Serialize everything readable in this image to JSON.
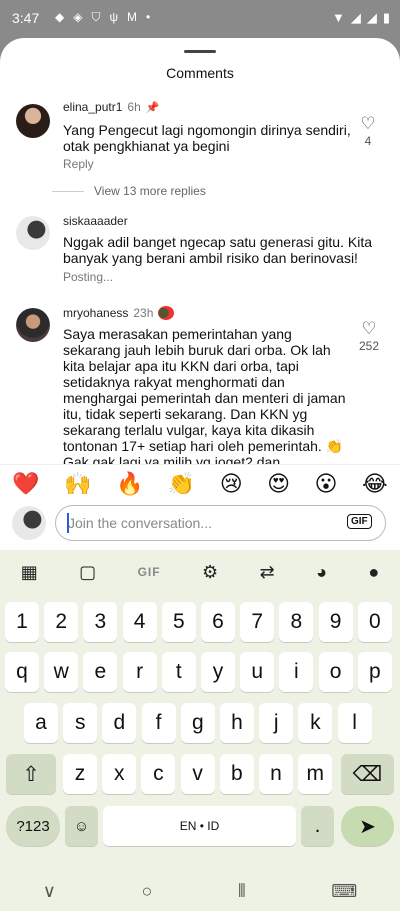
{
  "status_bar": {
    "time": "3:47",
    "left_icons": [
      "message-icon",
      "hotspot-icon",
      "vpn-icon",
      "usb-icon",
      "gmail-icon",
      "dot-icon"
    ],
    "right_icons": [
      "wifi-icon",
      "signal-icon",
      "signal-icon",
      "battery-icon"
    ]
  },
  "sheet": {
    "title": "Comments"
  },
  "comments": [
    {
      "username": "elina_putr1",
      "time": "6h",
      "pinned": true,
      "text": "Yang Pengecut lagi ngomongin dirinya sendiri, otak pengkhianat ya begini",
      "reply_label": "Reply",
      "likes": "4",
      "view_replies": "View 13 more replies"
    },
    {
      "username": "siskaaaader",
      "text": "Nggak adil banget ngecap satu generasi gitu. Kita banyak yang berani ambil risiko dan berinovasi!",
      "status": "Posting..."
    },
    {
      "username": "mryohaness",
      "time": "23h",
      "likes": "252",
      "text": "Saya merasakan pemerintahan yang sekarang jauh lebih buruk dari orba. Ok lah kita belajar apa itu KKN dari orba, tapi setidaknya rakyat menghormati dan menghargai pemerintah dan menteri di jaman itu, tidak seperti sekarang. Dan KKN yg sekarang terlalu vulgar, kaya kita dikasih tontonan 17+ setiap hari oleh pemerintah. 👏 Gak gak lagi ya milih yg joget2 dan"
    }
  ],
  "emoji_bar": [
    "❤️",
    "🙌",
    "🔥",
    "👏",
    "😢",
    "😍",
    "😮",
    "😂"
  ],
  "input": {
    "placeholder": "Join the conversation...",
    "gif_label": "GIF"
  },
  "keyboard": {
    "toolbar": {
      "gif_label": "GIF"
    },
    "row_numbers": [
      "1",
      "2",
      "3",
      "4",
      "5",
      "6",
      "7",
      "8",
      "9",
      "0"
    ],
    "row1": [
      "q",
      "w",
      "e",
      "r",
      "t",
      "y",
      "u",
      "i",
      "o",
      "p"
    ],
    "row2": [
      "a",
      "s",
      "d",
      "f",
      "g",
      "h",
      "j",
      "k",
      "l"
    ],
    "row3": [
      "z",
      "x",
      "c",
      "v",
      "b",
      "n",
      "m"
    ],
    "symbols_label": "?123",
    "space_label": "EN • ID",
    "period_label": ".",
    "shift_glyph": "⇧",
    "backspace_glyph": "⌫",
    "enter_glyph": "➤",
    "emoji_glyph": "☺"
  },
  "nav": {
    "back": "∨",
    "home": "○",
    "recents": "⦀",
    "keyboard": "⌨"
  }
}
